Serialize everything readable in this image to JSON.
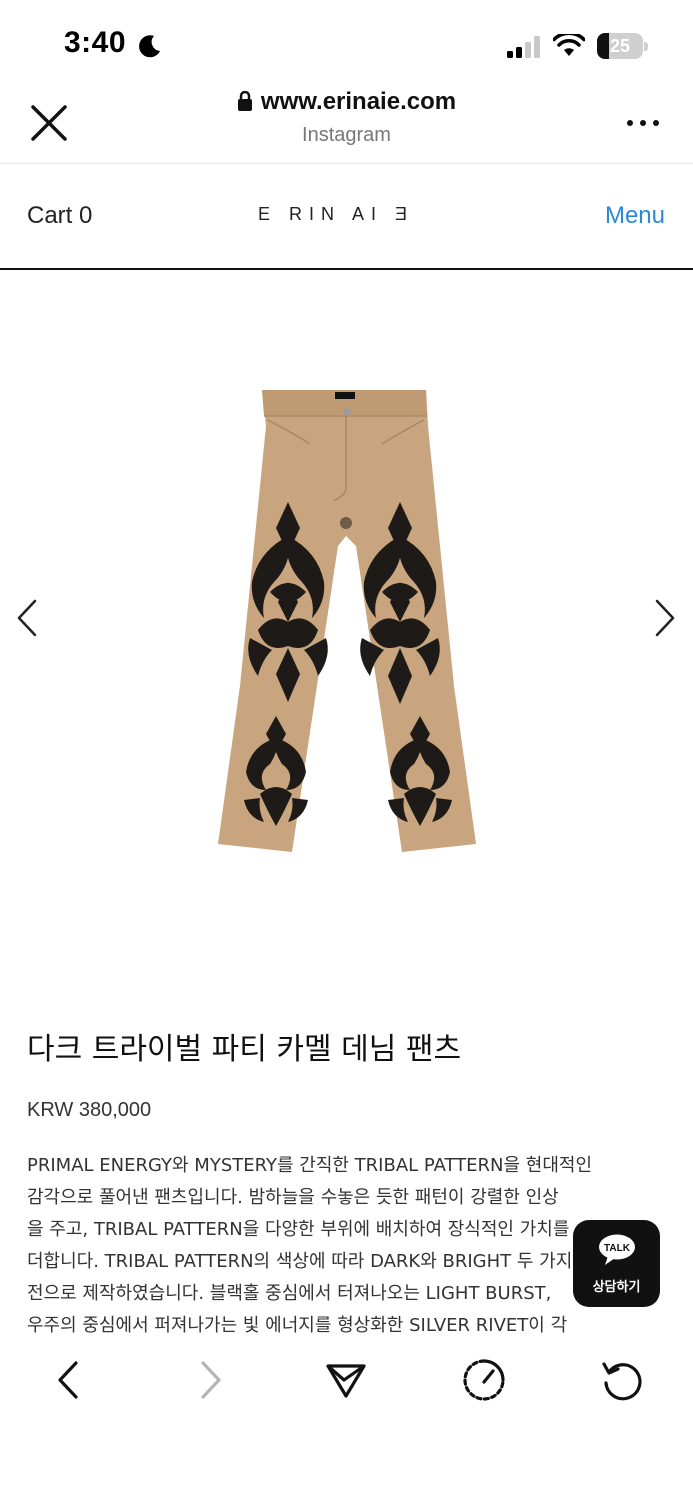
{
  "status_bar": {
    "time": "3:40",
    "battery_level": "25",
    "battery_fraction": 0.25
  },
  "browser": {
    "url": "www.erinaie.com",
    "source": "Instagram"
  },
  "site_nav": {
    "cart_label": "Cart 0",
    "logo_text": "E RIN AI Ǝ",
    "menu_label": "Menu",
    "menu_color": "#2b8ad8"
  },
  "product": {
    "title": "다크 트라이벌 파티 카멜 데님 팬츠",
    "price": "KRW 380,000",
    "description_lines": [
      "PRIMAL ENERGY와 MYSTERY를 간직한 TRIBAL PATTERN을 현대적인",
      "감각으로 풀어낸 팬츠입니다. 밤하늘을 수놓은 듯한 패턴이 강렬한 인상",
      "을 주고, TRIBAL PATTERN을 다양한 부위에 배치하여 장식적인 가치를",
      "더합니다. TRIBAL PATTERN의 색상에 따라 DARK와 BRIGHT 두 가지 버",
      "전으로 제작하였습니다. 블랙홀 중심에서 터져나오는 LIGHT BURST,",
      "우주의 중심에서 퍼져나가는 빛 에너지를 형상화한 SILVER RIVET이 각"
    ]
  },
  "talk_button": {
    "badge": "TALK",
    "label": "상담하기"
  },
  "icons": {
    "close": "close-icon",
    "lock": "lock-icon",
    "more": "more-icon",
    "prev": "chevron-left-icon",
    "next": "chevron-right-icon",
    "back": "back-icon",
    "forward": "forward-icon",
    "share": "share-icon",
    "speed": "speed-icon",
    "reload": "reload-icon"
  },
  "colors": {
    "pants_tan": "#c8a57f",
    "pattern_black": "#1e1a17",
    "accent_blue": "#2b8ad8"
  }
}
